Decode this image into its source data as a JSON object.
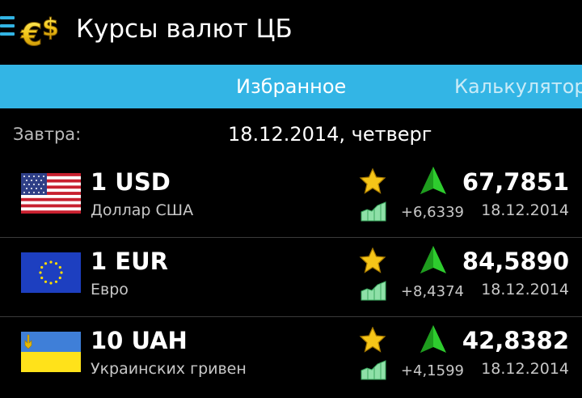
{
  "app": {
    "title": "Курсы валют ЦБ"
  },
  "tabs": {
    "active": "Избранное",
    "next": "Калькулятор"
  },
  "date_row": {
    "label": "Завтра:",
    "value": "18.12.2014, четверг"
  },
  "colors": {
    "accent": "#33b5e5",
    "background": "#000000",
    "trend_up": "#2ecc2e",
    "star": "#f5c518"
  },
  "rates": [
    {
      "code": "1 USD",
      "name": "Доллар США",
      "change": "+6,6339",
      "rate": "67,7851",
      "date": "18.12.2014",
      "flag": "us-flag",
      "trend": "up"
    },
    {
      "code": "1 EUR",
      "name": "Евро",
      "change": "+8,4374",
      "rate": "84,5890",
      "date": "18.12.2014",
      "flag": "eu-flag",
      "trend": "up"
    },
    {
      "code": "10 UAH",
      "name": "Украинских гривен",
      "change": "+4,1599",
      "rate": "42,8382",
      "date": "18.12.2014",
      "flag": "ua-flag",
      "trend": "up"
    }
  ]
}
